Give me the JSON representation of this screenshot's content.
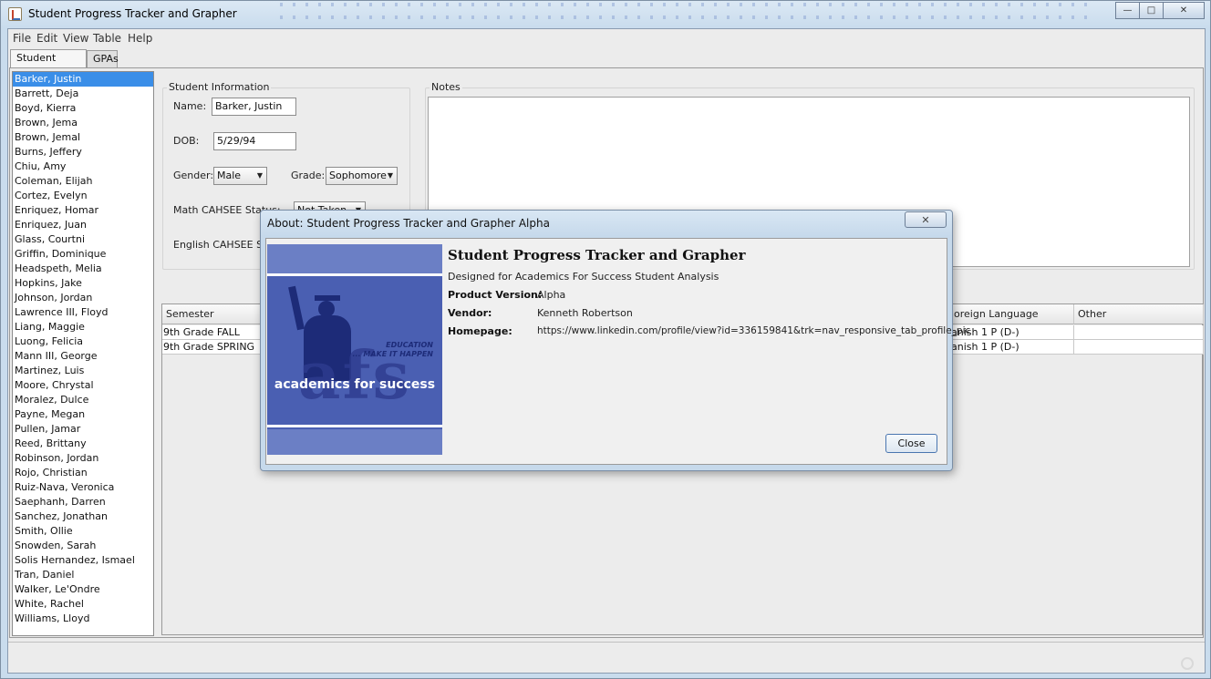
{
  "window": {
    "title": "Student Progress Tracker and Grapher",
    "controls": {
      "minimize": "—",
      "maximize": "□",
      "close": "✕"
    }
  },
  "menu": [
    "File",
    "Edit",
    "View",
    "Table",
    "Help"
  ],
  "tabs": [
    "Student Listing",
    "GPAs"
  ],
  "students": [
    "Barker, Justin",
    "Barrett, Deja",
    "Boyd, Kierra",
    "Brown, Jema",
    "Brown, Jemal",
    "Burns, Jeffery",
    "Chiu, Amy",
    "Coleman, Elijah",
    "Cortez, Evelyn",
    "Enriquez, Homar",
    "Enriquez, Juan",
    "Glass, Courtni",
    "Griffin, Dominique",
    "Headspeth, Melia",
    "Hopkins, Jake",
    "Johnson, Jordan",
    "Lawrence III, Floyd",
    "Liang, Maggie",
    "Luong, Felicia",
    "Mann III, George",
    "Martinez, Luis",
    "Moore, Chrystal",
    "Moralez, Dulce",
    "Payne, Megan",
    "Pullen, Jamar",
    "Reed, Brittany",
    "Robinson, Jordan",
    "Rojo, Christian",
    "Ruiz-Nava, Veronica",
    "Saephanh, Darren",
    "Sanchez, Jonathan",
    "Smith, Ollie",
    "Snowden, Sarah",
    "Solis Hernandez, Ismael",
    "Tran, Daniel",
    "Walker, Le'Ondre",
    "White, Rachel",
    "Williams, Lloyd"
  ],
  "student_info": {
    "legend": "Student Information",
    "name_label": "Name:",
    "name_value": "Barker, Justin",
    "dob_label": "DOB:",
    "dob_value": "5/29/94",
    "gender_label": "Gender:",
    "gender_value": "Male",
    "grade_label": "Grade:",
    "grade_value": "Sophomore",
    "math_label": "Math CAHSEE Status:",
    "math_value": "Not Taken",
    "english_label": "English CAHSEE Stat"
  },
  "notes": {
    "legend": "Notes"
  },
  "grades_table": {
    "headers": {
      "semester": "Semester",
      "foreign_language": "oreign Language",
      "other": "Other"
    },
    "rows": [
      {
        "semester": "9th Grade FALL",
        "foreign_language": "anish 1 P (D-)",
        "other": ""
      },
      {
        "semester": "9th Grade SPRING",
        "foreign_language": "anish 1 P (D-)",
        "other": ""
      }
    ]
  },
  "about_dialog": {
    "title": "About: Student Progress Tracker and Grapher Alpha",
    "close_x": "✕",
    "product_title": "Student Progress Tracker and Grapher",
    "description": "Designed for Academics For Success Student Analysis",
    "fields": [
      {
        "key": "Product Version:",
        "value": "Alpha"
      },
      {
        "key": "Vendor:",
        "value": "Kenneth Robertson"
      },
      {
        "key": "Homepage:",
        "value": "https://www.linkedin.com/profile/view?id=336159841&trk=nav_responsive_tab_profile_pic"
      }
    ],
    "logo": {
      "text": "academics for success",
      "tagline_1": "EDUCATION",
      "tagline_2": "... MAKE IT HAPPEN",
      "letters": "afs"
    },
    "close_button": "Close"
  }
}
